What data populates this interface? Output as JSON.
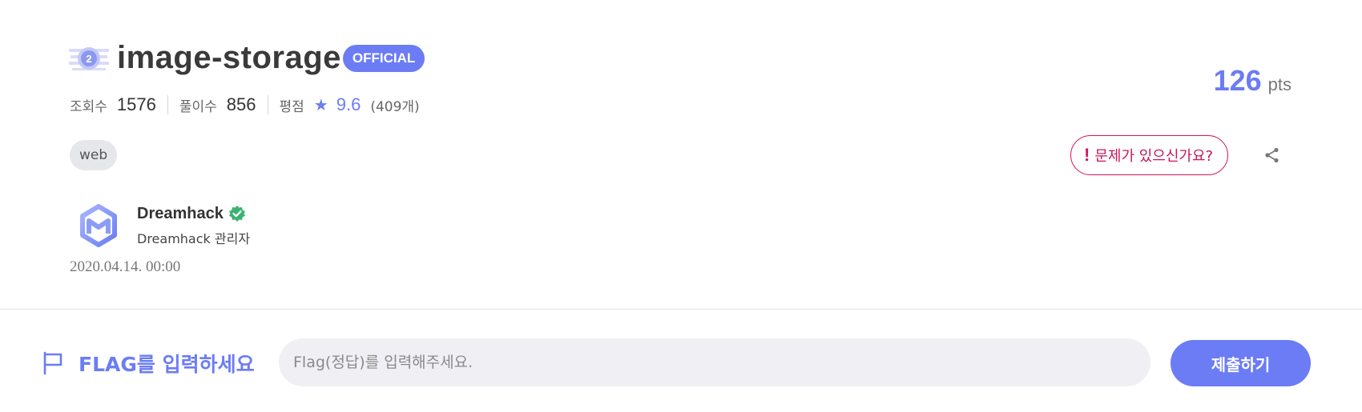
{
  "challenge": {
    "level_icon": "level-2-badge-icon",
    "title": "image-storage",
    "official_badge": "OFFICIAL",
    "stats": {
      "views_label": "조회수",
      "views": "1576",
      "solves_label": "풀이수",
      "solves": "856",
      "rating_label": "평점",
      "rating": "9.6",
      "rating_count": "(409개)"
    },
    "tags": [
      "web"
    ],
    "author": {
      "name": "Dreamhack",
      "role": "Dreamhack 관리자",
      "verified": true
    },
    "date": "2020.04.14. 00:00",
    "points": "126",
    "points_unit": "pts",
    "report_label": "문제가 있으신가요?",
    "report_mark": "!"
  },
  "flag_form": {
    "label": "FLAG를 입력하세요",
    "placeholder": "Flag(정답)를 입력해주세요.",
    "value": "",
    "submit_label": "제출하기"
  },
  "colors": {
    "accent": "#6b7cf4",
    "report": "#d6145f",
    "verified": "#3cb371"
  }
}
